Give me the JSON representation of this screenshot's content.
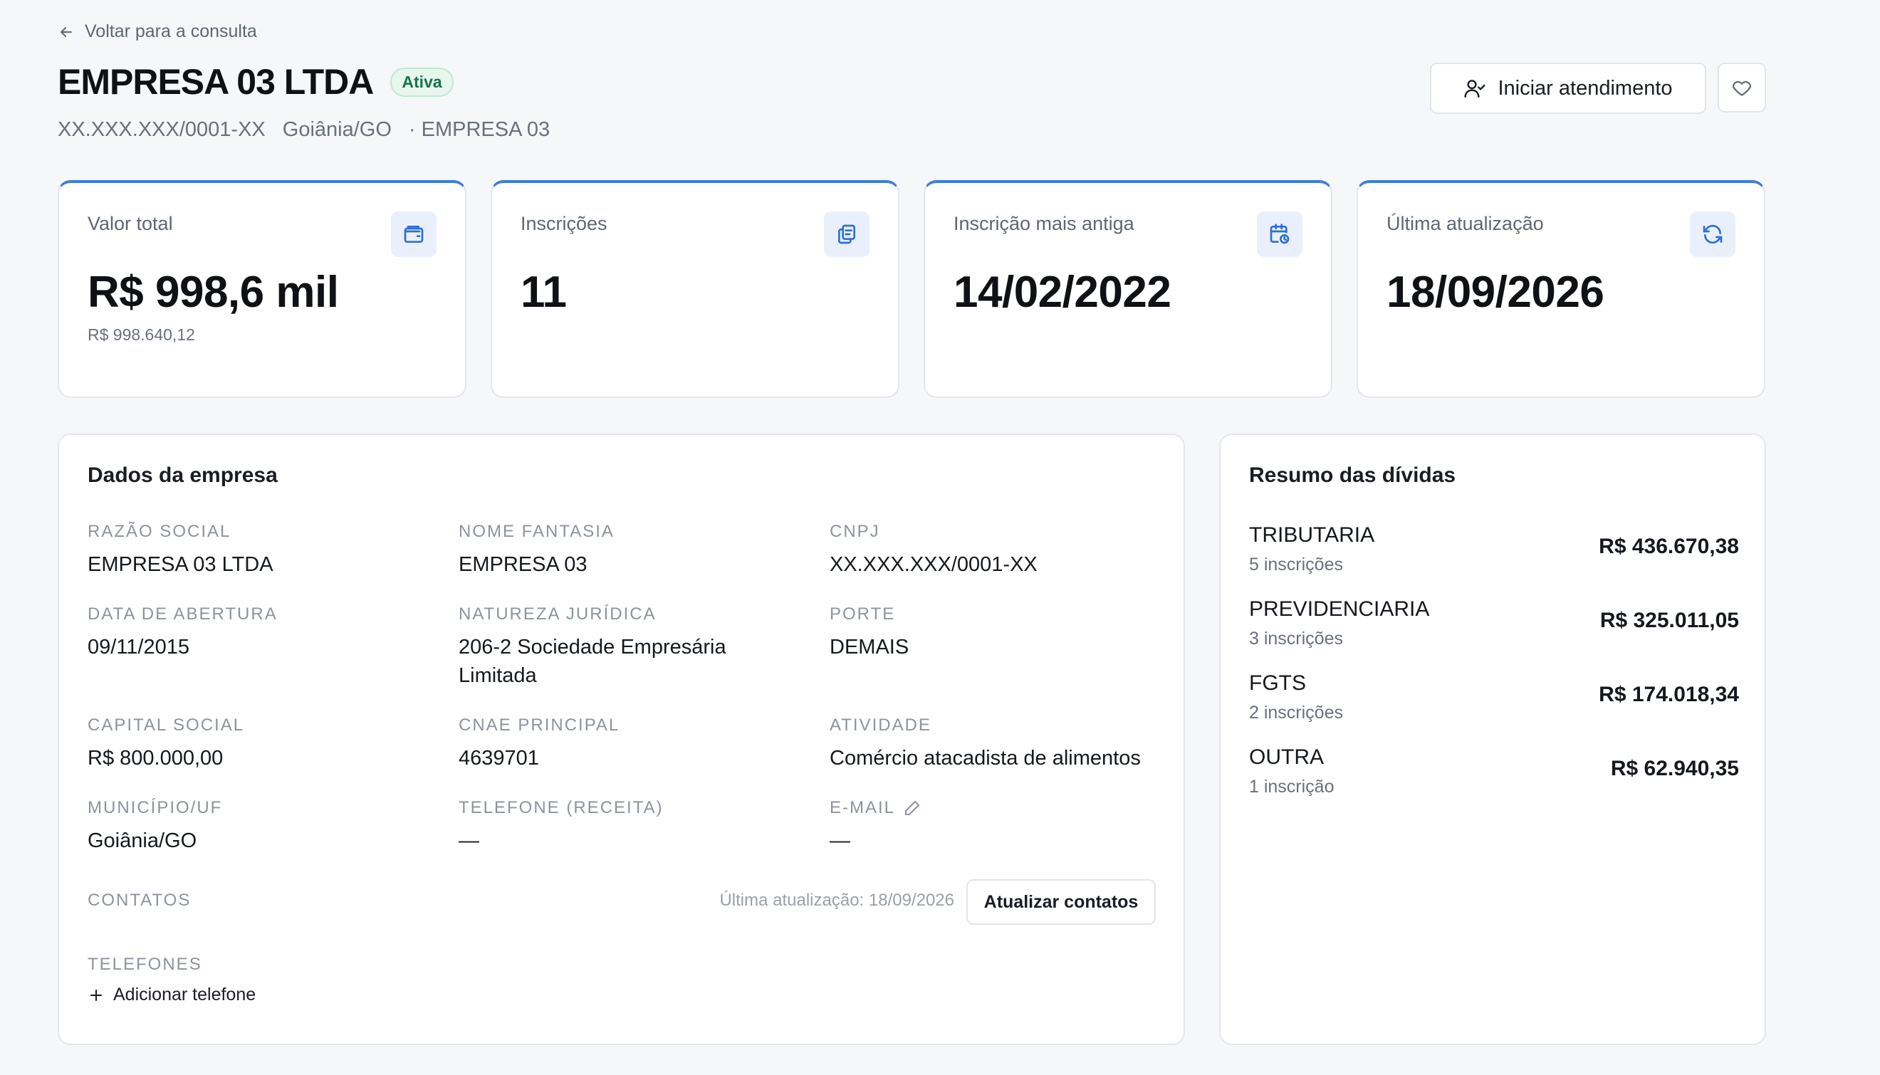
{
  "header": {
    "back_label": "Voltar para a consulta",
    "title": "EMPRESA 03 LTDA",
    "status": "Ativa",
    "cnpj": "XX.XXX.XXX/0001-XX",
    "city": "Goiânia/GO",
    "trade_name": "· EMPRESA 03",
    "start_button": "Iniciar atendimento"
  },
  "stats": [
    {
      "label": "Valor total",
      "value": "R$ 998,6 mil",
      "sub": "R$ 998.640,12",
      "icon": "wallet-icon"
    },
    {
      "label": "Inscrições",
      "value": "11",
      "sub": "",
      "icon": "documents-icon"
    },
    {
      "label": "Inscrição mais antiga",
      "value": "14/02/2022",
      "sub": "",
      "icon": "calendar-clock-icon"
    },
    {
      "label": "Última atualização",
      "value": "18/09/2026",
      "sub": "",
      "icon": "refresh-icon"
    }
  ],
  "company": {
    "title": "Dados da empresa",
    "fields": {
      "razao_social": {
        "label": "RAZÃO SOCIAL",
        "value": "EMPRESA 03 LTDA"
      },
      "nome_fantasia": {
        "label": "NOME FANTASIA",
        "value": "EMPRESA 03"
      },
      "cnpj": {
        "label": "CNPJ",
        "value": "XX.XXX.XXX/0001-XX"
      },
      "data_abertura": {
        "label": "DATA DE ABERTURA",
        "value": "09/11/2015"
      },
      "natureza_juridica": {
        "label": "NATUREZA JURÍDICA",
        "value": "206-2 Sociedade Empresária Limitada"
      },
      "porte": {
        "label": "PORTE",
        "value": "DEMAIS"
      },
      "capital_social": {
        "label": "CAPITAL SOCIAL",
        "value": "R$ 800.000,00"
      },
      "cnae": {
        "label": "CNAE PRINCIPAL",
        "value": "4639701"
      },
      "atividade": {
        "label": "ATIVIDADE",
        "value": "Comércio atacadista de alimentos"
      },
      "municipio": {
        "label": "MUNICÍPIO/UF",
        "value": "Goiânia/GO"
      },
      "telefone": {
        "label": "TELEFONE (RECEITA)",
        "value": "—"
      },
      "email": {
        "label": "E-MAIL",
        "value": "—"
      }
    },
    "contacts_label": "CONTATOS",
    "contacts_updated": "Última atualização: 18/09/2026",
    "update_contacts_button": "Atualizar contatos",
    "phones_label": "TELEFONES",
    "add_phone": "Adicionar telefone"
  },
  "debts": {
    "title": "Resumo das dívidas",
    "items": [
      {
        "name": "TRIBUTARIA",
        "count": "5 inscrições",
        "amount": "R$ 436.670,38"
      },
      {
        "name": "PREVIDENCIARIA",
        "count": "3 inscrições",
        "amount": "R$ 325.011,05"
      },
      {
        "name": "FGTS",
        "count": "2 inscrições",
        "amount": "R$ 174.018,34"
      },
      {
        "name": "OUTRA",
        "count": "1 inscrição",
        "amount": "R$ 62.940,35"
      }
    ]
  },
  "colors": {
    "accent": "#3b7de0",
    "status_green": "#17754a",
    "background": "#f6f7f9"
  }
}
